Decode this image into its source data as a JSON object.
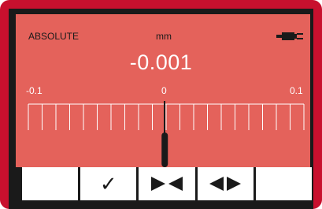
{
  "status": {
    "mode": "ABSOLUTE",
    "unit": "mm",
    "power_icon": "plug-icon"
  },
  "reading": {
    "value": "-0.001",
    "current": -0.001
  },
  "scale": {
    "min_label": "-0.1",
    "zero_label": "0",
    "max_label": "0.1",
    "min": -0.1,
    "max": 0.1,
    "major_divisions": 20
  },
  "softkeys": [
    {
      "name": "empty-1",
      "icon": "",
      "label": ""
    },
    {
      "name": "confirm",
      "icon": "checkmark-icon",
      "label": "✓"
    },
    {
      "name": "zero",
      "icon": "bowtie-arrows-icon",
      "label": ""
    },
    {
      "name": "range",
      "icon": "outward-arrows-icon",
      "label": ""
    },
    {
      "name": "empty-2",
      "icon": "",
      "label": ""
    }
  ],
  "colors": {
    "frame": "#c8102e",
    "display": "#e4625b",
    "text": "#ffffff",
    "ink": "#1a1a1a"
  }
}
